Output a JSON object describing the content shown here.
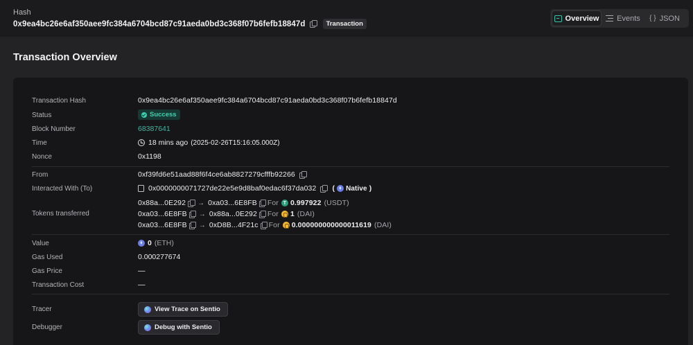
{
  "header": {
    "hash_label": "Hash",
    "hash_value": "0x9ea4bc26e6af350aee9fc384a6704bcd87c91aeda0bd3c368f07b6fefb18847d",
    "tag": "Transaction"
  },
  "tabs": [
    {
      "label": "Overview",
      "icon": "overview-icon",
      "active": true
    },
    {
      "label": "Events",
      "icon": "list-icon",
      "active": false
    },
    {
      "label": "JSON",
      "icon": "braces-icon",
      "active": false
    }
  ],
  "section_title": "Transaction Overview",
  "overview": {
    "tx_hash_label": "Transaction Hash",
    "tx_hash": "0x9ea4bc26e6af350aee9fc384a6704bcd87c91aeda0bd3c368f07b6fefb18847d",
    "status_label": "Status",
    "status": "Success",
    "block_label": "Block Number",
    "block": "68387641",
    "time_label": "Time",
    "time_relative": "18 mins ago",
    "time_absolute": "(2025-02-26T15:16:05.000Z)",
    "nonce_label": "Nonce",
    "nonce": "0x1198",
    "from_label": "From",
    "from": "0xf39fd6e51aad88f6f4ce6ab8827279cfffb92266",
    "to_label": "Interacted With (To)",
    "to": "0x0000000071727de22e5e9d8baf0edac6f37da032",
    "to_suffix_open": "(",
    "to_native": "Native",
    "to_suffix_close": ")",
    "tokens_label": "Tokens transferred",
    "for_label": "For",
    "transfers": [
      {
        "from": "0x88a...0E292",
        "to": "0xa03...6E8FB",
        "amount": "0.997922",
        "symbol": "(USDT)",
        "token_icon": "usdt-icon"
      },
      {
        "from": "0xa03...6E8FB",
        "to": "0x88a...0E292",
        "amount": "1",
        "symbol": "(DAI)",
        "token_icon": "dai-icon"
      },
      {
        "from": "0xa03...6E8FB",
        "to": "0xD8B...4F21c",
        "amount": "0.000000000000011619",
        "symbol": "(DAI)",
        "token_icon": "dai-icon"
      }
    ],
    "value_label": "Value",
    "value": "0",
    "value_symbol": "(ETH)",
    "gas_used_label": "Gas Used",
    "gas_used": "0.000277674",
    "gas_price_label": "Gas Price",
    "gas_price": "—",
    "tx_cost_label": "Transaction Cost",
    "tx_cost": "—",
    "tracer_label": "Tracer",
    "tracer_button": "View Trace on Sentio",
    "debugger_label": "Debugger",
    "debugger_button": "Debug with Sentio"
  },
  "colors": {
    "accent": "#3cb9a6",
    "success_bg": "#163a33",
    "success_fg": "#3fd0b1"
  }
}
